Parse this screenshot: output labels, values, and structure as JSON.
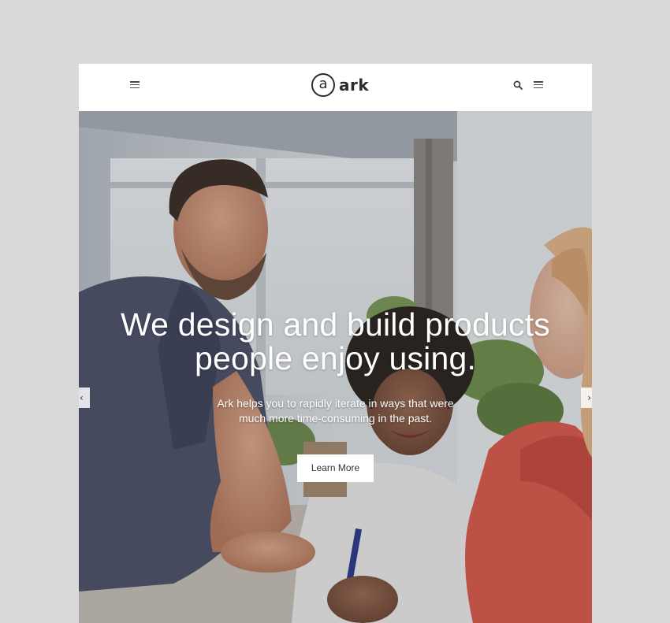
{
  "header": {
    "logo_mark": "a",
    "logo_text": "ark",
    "left_menu_icon": "hamburger-icon",
    "search_icon": "search-icon",
    "right_menu_icon": "hamburger-icon"
  },
  "hero": {
    "headline_line1": "We design and build products",
    "headline_line2": "people enjoy using.",
    "subtext_line1": "Ark helps you to rapidly iterate in ways that were",
    "subtext_line2": "much more time-consuming in the past.",
    "cta_label": "Learn More",
    "prev_arrow": "‹",
    "next_arrow": "›"
  },
  "colors": {
    "page_background": "#d9d9d9",
    "header_background": "#ffffff",
    "logo_color": "#2b2b2b",
    "headline_color": "#ffffff",
    "cta_background": "#ffffff"
  }
}
